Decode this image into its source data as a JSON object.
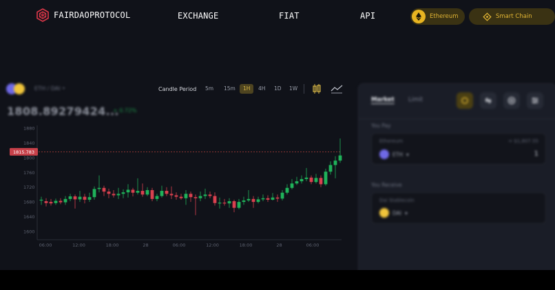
{
  "nav": {
    "brand": "FAIRDAOPROTOCOL",
    "links": [
      "EXCHANGE",
      "FIAT",
      "API"
    ],
    "network_pill": "Ethereum",
    "chain_pill": "Smart Chain"
  },
  "pair": {
    "label": "ETH / DAI •",
    "price": "1808.89279424...",
    "change": "+ 0.72%"
  },
  "toolbar": {
    "candle_period_label": "Candle Period",
    "periods": [
      "5m",
      "15m",
      "1H",
      "4H",
      "1D",
      "1W"
    ],
    "active_period": "1H"
  },
  "chart_data": {
    "type": "candlestick",
    "y_ticks": [
      "1600",
      "1640",
      "1680",
      "1720",
      "1760",
      "1800",
      "1840",
      "1880"
    ],
    "ylim": [
      1600,
      1880
    ],
    "x_ticks": [
      "06:00",
      "12:00",
      "18:00",
      "28",
      "06:00",
      "12:00",
      "18:00",
      "28",
      "06:00"
    ],
    "current_price_label": "1815.783",
    "current_price": 1815.78,
    "colors": {
      "up": "#1fb25a",
      "down": "#d9414f",
      "price_line": "#b5403b"
    },
    "candles": [
      [
        1684,
        1686,
        1694,
        1672
      ],
      [
        1682,
        1677,
        1690,
        1668
      ],
      [
        1680,
        1676,
        1688,
        1670
      ],
      [
        1677,
        1683,
        1689,
        1672
      ],
      [
        1683,
        1679,
        1690,
        1674
      ],
      [
        1679,
        1688,
        1696,
        1672
      ],
      [
        1688,
        1695,
        1702,
        1682
      ],
      [
        1695,
        1687,
        1700,
        1662
      ],
      [
        1687,
        1694,
        1710,
        1680
      ],
      [
        1694,
        1686,
        1702,
        1676
      ],
      [
        1686,
        1693,
        1705,
        1680
      ],
      [
        1693,
        1715,
        1722,
        1686
      ],
      [
        1715,
        1718,
        1752,
        1706
      ],
      [
        1718,
        1708,
        1724,
        1696
      ],
      [
        1708,
        1702,
        1716,
        1690
      ],
      [
        1702,
        1698,
        1712,
        1692
      ],
      [
        1698,
        1702,
        1718,
        1688
      ],
      [
        1702,
        1706,
        1714,
        1690
      ],
      [
        1706,
        1713,
        1728,
        1692
      ],
      [
        1713,
        1705,
        1718,
        1695
      ],
      [
        1705,
        1710,
        1744,
        1700
      ],
      [
        1710,
        1700,
        1730,
        1694
      ],
      [
        1700,
        1712,
        1720,
        1696
      ],
      [
        1712,
        1688,
        1718,
        1682
      ],
      [
        1688,
        1696,
        1702,
        1682
      ],
      [
        1696,
        1710,
        1724,
        1692
      ],
      [
        1710,
        1702,
        1720,
        1696
      ],
      [
        1702,
        1698,
        1722,
        1688
      ],
      [
        1698,
        1694,
        1706,
        1686
      ],
      [
        1694,
        1690,
        1702,
        1686
      ],
      [
        1690,
        1702,
        1712,
        1672
      ],
      [
        1702,
        1693,
        1708,
        1680
      ],
      [
        1693,
        1690,
        1700,
        1644
      ],
      [
        1690,
        1696,
        1708,
        1682
      ],
      [
        1696,
        1700,
        1716,
        1688
      ],
      [
        1700,
        1696,
        1708,
        1690
      ],
      [
        1696,
        1677,
        1706,
        1670
      ],
      [
        1677,
        1678,
        1692,
        1662
      ],
      [
        1678,
        1676,
        1688,
        1670
      ],
      [
        1676,
        1682,
        1690,
        1664
      ],
      [
        1682,
        1664,
        1686,
        1652
      ],
      [
        1664,
        1680,
        1688,
        1660
      ],
      [
        1680,
        1684,
        1694,
        1672
      ],
      [
        1684,
        1688,
        1712,
        1680
      ],
      [
        1688,
        1680,
        1696,
        1664
      ],
      [
        1680,
        1687,
        1694,
        1676
      ],
      [
        1687,
        1690,
        1700,
        1682
      ],
      [
        1690,
        1686,
        1698,
        1680
      ],
      [
        1686,
        1692,
        1704,
        1684
      ],
      [
        1692,
        1689,
        1700,
        1680
      ],
      [
        1689,
        1705,
        1712,
        1684
      ],
      [
        1705,
        1718,
        1728,
        1700
      ],
      [
        1718,
        1730,
        1742,
        1714
      ],
      [
        1730,
        1736,
        1748,
        1726
      ],
      [
        1736,
        1742,
        1752,
        1730
      ],
      [
        1742,
        1746,
        1772,
        1736
      ],
      [
        1746,
        1734,
        1752,
        1728
      ],
      [
        1734,
        1745,
        1756,
        1730
      ],
      [
        1745,
        1728,
        1752,
        1720
      ],
      [
        1728,
        1762,
        1770,
        1724
      ],
      [
        1762,
        1780,
        1790,
        1754
      ],
      [
        1780,
        1792,
        1804,
        1744
      ],
      [
        1792,
        1806,
        1852,
        1786
      ]
    ]
  },
  "trade": {
    "tabs": [
      "Market",
      "Limit"
    ],
    "pay_label": "You Pay",
    "pay_token_name": "Ethereum",
    "pay_balance": "= $1,807.55",
    "pay_token": "ETH",
    "pay_amount": "1",
    "receive_label": "You Receive",
    "receive_token_name": "Dai Stablecoin",
    "receive_token": "DAI"
  }
}
